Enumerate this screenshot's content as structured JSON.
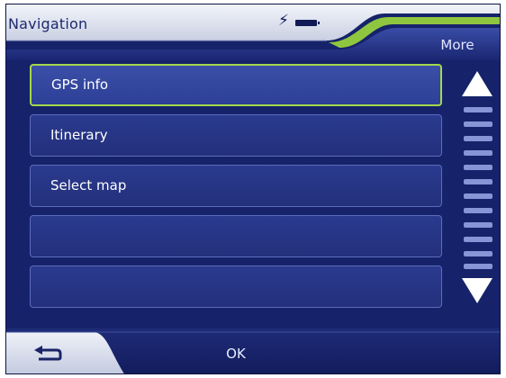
{
  "header": {
    "title": "Navigation",
    "power_icon": "lightning-icon",
    "battery_icon": "battery-icon",
    "more_label": "More"
  },
  "menu": {
    "items": [
      {
        "label": "GPS info",
        "selected": true
      },
      {
        "label": "Itinerary",
        "selected": false
      },
      {
        "label": "Select map",
        "selected": false
      },
      {
        "label": "",
        "selected": false
      },
      {
        "label": "",
        "selected": false
      }
    ]
  },
  "scrollbar": {
    "up_icon": "triangle-up-icon",
    "down_icon": "triangle-down-icon"
  },
  "footer": {
    "back_icon": "return-arrow-icon",
    "ok_label": "OK"
  },
  "colors": {
    "background": "#16236a",
    "header": "#dde3f0",
    "accent_green": "#a3d84a",
    "list_item": "#2a3a8e",
    "list_border": "#5c6cbd"
  }
}
